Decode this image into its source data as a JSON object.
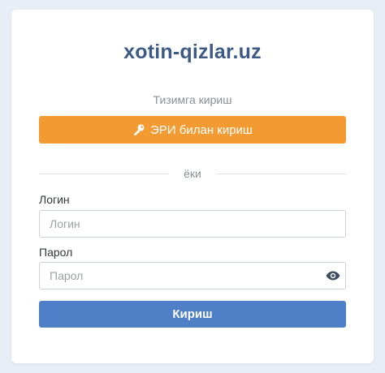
{
  "header": {
    "site_title": "xotin-qizlar.uz",
    "subtitle": "Тизимга кириш"
  },
  "eri_button": {
    "label": "ЭРИ билан кириш",
    "icon": "key-icon"
  },
  "divider": {
    "text": "ёки"
  },
  "login": {
    "label": "Логин",
    "placeholder": "Логин",
    "value": ""
  },
  "password": {
    "label": "Парол",
    "placeholder": "Парол",
    "value": "",
    "toggle_icon": "eye-icon"
  },
  "submit": {
    "label": "Кириш"
  },
  "colors": {
    "background": "#e9eef6",
    "title": "#3e5a86",
    "eri_button": "#f39a33",
    "submit_button": "#4f7fc7"
  }
}
